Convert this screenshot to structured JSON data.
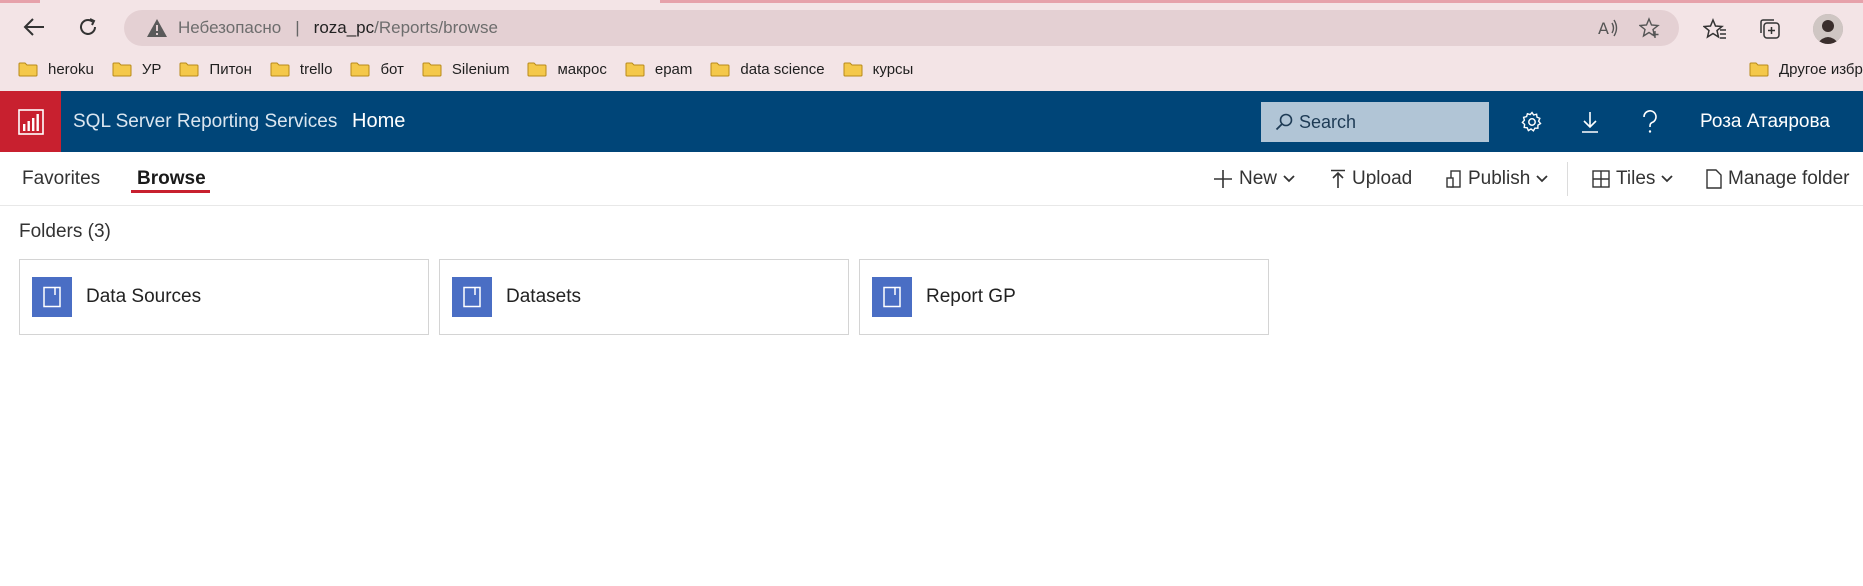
{
  "browser": {
    "address": {
      "security_text": "Небезопасно",
      "separator": "|",
      "host": "roza_pc",
      "path": "/Reports/browse"
    },
    "bookmarks": [
      {
        "label": "heroku"
      },
      {
        "label": "УР"
      },
      {
        "label": "Питон"
      },
      {
        "label": "trello"
      },
      {
        "label": "бот"
      },
      {
        "label": "Silenium"
      },
      {
        "label": "макрос"
      },
      {
        "label": "epam"
      },
      {
        "label": "data science"
      },
      {
        "label": "курсы"
      }
    ],
    "other_bookmarks_label": "Другое избр"
  },
  "header": {
    "brand": "SQL Server Reporting Services",
    "home": "Home",
    "search_placeholder": "Search",
    "user_name": "Роза Атаярова"
  },
  "tabs": [
    {
      "label": "Favorites",
      "active": false
    },
    {
      "label": "Browse",
      "active": true
    }
  ],
  "commands": {
    "new": "New",
    "upload": "Upload",
    "publish": "Publish",
    "tiles": "Tiles",
    "manage_folder": "Manage folder"
  },
  "folders_title": "Folders (3)",
  "folders": [
    {
      "name": "Data Sources"
    },
    {
      "name": "Datasets"
    },
    {
      "name": "Report GP"
    }
  ],
  "colors": {
    "header_bg": "#004578",
    "logo_bg": "#c8202f",
    "tile_icon": "#4a6ec4",
    "active_tab_underline": "#c8202f",
    "browser_chrome": "#f3e4e6"
  }
}
